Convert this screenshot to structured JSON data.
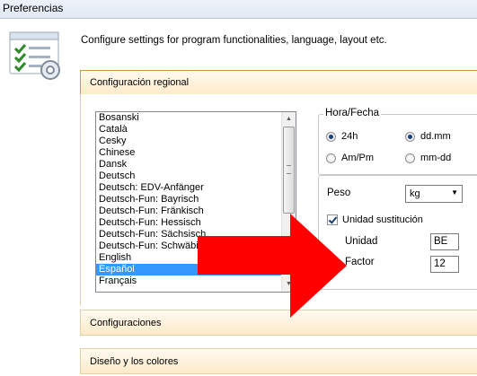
{
  "window": {
    "title": "Preferencias"
  },
  "header": {
    "description": "Configure settings for program functionalities, language, layout etc.",
    "icon": "settings-checklist-icon"
  },
  "sections": {
    "regional": "Configuración regional",
    "configuraciones": "Configuraciones",
    "diseno": "Diseño y los colores"
  },
  "languages": [
    "Bosanski",
    "Català",
    "Cesky",
    "Chinese",
    "Dansk",
    "Deutsch",
    "Deutsch: EDV-Anfänger",
    "Deutsch-Fun: Bayrisch",
    "Deutsch-Fun: Fränkisch",
    "Deutsch-Fun: Hessisch",
    "Deutsch-Fun: Sächsisch",
    "Deutsch-Fun: Schwäbisch",
    "English",
    "Español",
    "Français"
  ],
  "selected_language": "Español",
  "hora_fecha": {
    "title": "Hora/Fecha",
    "options": {
      "h24": "24h",
      "ampm": "Am/Pm",
      "ddmm": "dd.mm",
      "mmdd": "mm-dd"
    },
    "selected_time": "24h",
    "selected_date": "dd.mm"
  },
  "peso": {
    "label": "Peso",
    "unit_value": "kg",
    "substitution_label": "Unidad sustitución",
    "substitution_checked": true,
    "unidad_label": "Unidad",
    "unidad_value": "BE",
    "factor_label": "Factor",
    "factor_value": "12"
  },
  "colors": {
    "selection": "#3399ff",
    "section_bg": "#fdebc9",
    "arrow": "#ff0000"
  }
}
